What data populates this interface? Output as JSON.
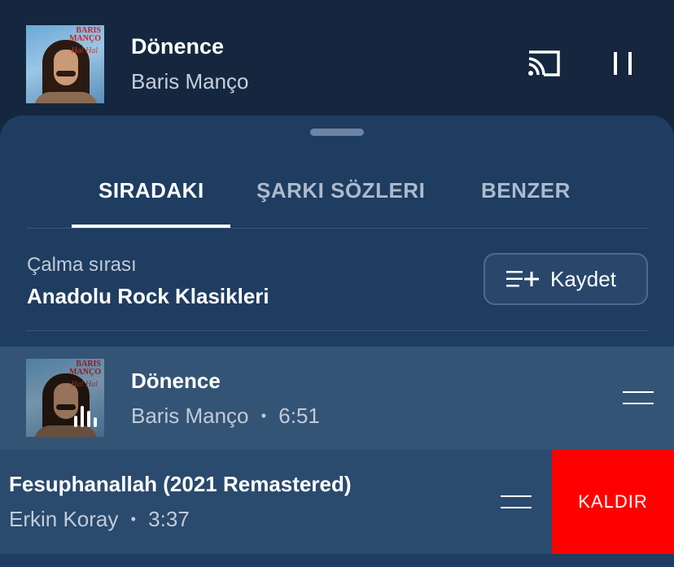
{
  "mini_player": {
    "title": "Dönence",
    "artist": "Baris Manço",
    "album_art_text": "BARIS MANÇO",
    "album_art_subtext": "Hal Hal",
    "cast_icon": "cast-icon",
    "pause_icon": "pause-icon"
  },
  "tabs": [
    {
      "label": "SIRADAKI",
      "active": true
    },
    {
      "label": "ŞARKI SÖZLERI",
      "active": false
    },
    {
      "label": "BENZER",
      "active": false
    }
  ],
  "queue": {
    "label": "Çalma sırası",
    "name": "Anadolu Rock Klasikleri",
    "save_label": "Kaydet",
    "save_icon": "playlist-add-icon"
  },
  "tracks": [
    {
      "title": "Dönence",
      "artist": "Baris Manço",
      "duration": "6:51",
      "separator": "•",
      "now_playing": true
    },
    {
      "title": "Fesuphanallah (2021 Remastered)",
      "artist": "Erkin Koray",
      "duration": "3:37",
      "separator": "•",
      "now_playing": false
    }
  ],
  "swipe_action": {
    "label": "KALDIR",
    "color": "#ff0000"
  },
  "colors": {
    "background": "#15273f",
    "sheet": "#1e3d61",
    "active_row": "#345476",
    "accent_remove": "#ff0000"
  }
}
